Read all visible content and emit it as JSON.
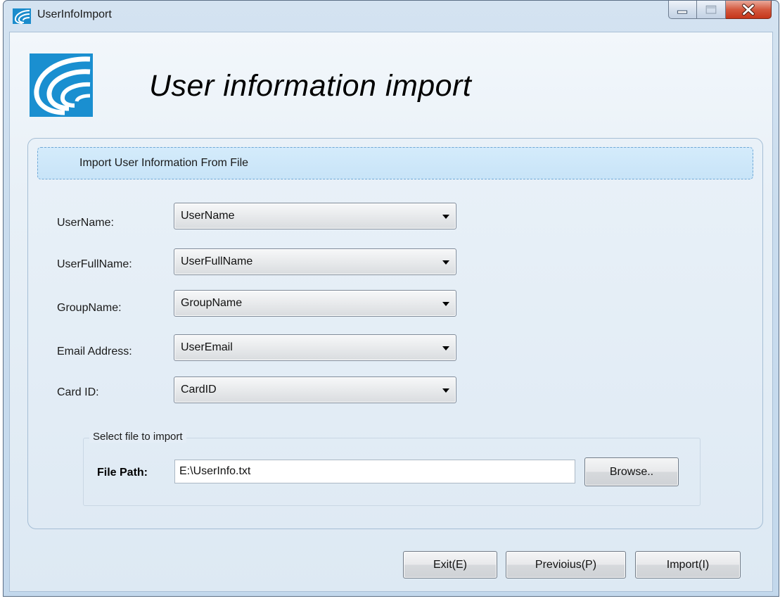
{
  "window": {
    "title": "UserInfoImport",
    "headline": "User information import"
  },
  "section": {
    "header": "Import User Information From File"
  },
  "fields": [
    {
      "label": "UserName:",
      "value": "UserName"
    },
    {
      "label": "UserFullName:",
      "value": "UserFullName"
    },
    {
      "label": "GroupName:",
      "value": "GroupName"
    },
    {
      "label": "Email Address:",
      "value": "UserEmail"
    },
    {
      "label": "Card ID:",
      "value": "CardID"
    }
  ],
  "file": {
    "legend": "Select file to import",
    "label": "File Path:",
    "value": "E:\\UserInfo.txt",
    "browse_label": "Browse.."
  },
  "footer": {
    "exit_label": "Exit(E)",
    "previous_label": "Previoius(P)",
    "import_label": "Import(I)"
  },
  "colors": {
    "brand": "#1a8fd0",
    "section_header_bg": "#c8e4f8",
    "close_button": "#c6361a"
  },
  "icons": [
    "app-logo-icon",
    "minimize-icon",
    "maximize-icon",
    "close-icon",
    "dropdown-arrow-icon"
  ]
}
